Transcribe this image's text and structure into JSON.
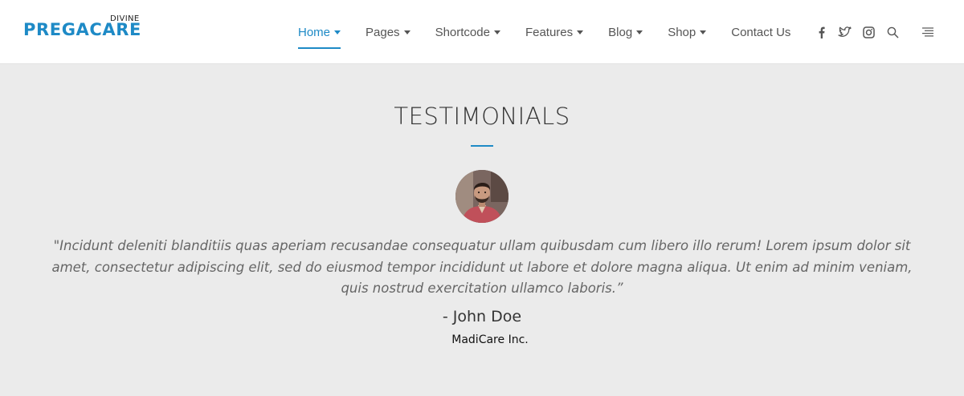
{
  "brand": {
    "logo_top": "DIVINE",
    "logo_main": "PREGACARE",
    "accent_color": "#1e8ac6"
  },
  "nav": {
    "items": [
      {
        "label": "Home",
        "has_dropdown": true,
        "active": true
      },
      {
        "label": "Pages",
        "has_dropdown": true,
        "active": false
      },
      {
        "label": "Shortcode",
        "has_dropdown": true,
        "active": false
      },
      {
        "label": "Features",
        "has_dropdown": true,
        "active": false
      },
      {
        "label": "Blog",
        "has_dropdown": true,
        "active": false
      },
      {
        "label": "Shop",
        "has_dropdown": true,
        "active": false
      },
      {
        "label": "Contact Us",
        "has_dropdown": false,
        "active": false
      }
    ]
  },
  "header_icons": [
    "facebook-icon",
    "twitter-icon",
    "instagram-icon",
    "search-icon",
    "menu-icon"
  ],
  "testimonials": {
    "title": "TESTIMONIALS",
    "quote": "\"Incidunt deleniti blanditiis quas aperiam recusandae consequatur ullam quibusdam cum libero illo rerum! Lorem ipsum dolor sit amet, consectetur adipiscing elit, sed do eiusmod tempor incididunt ut labore et dolore magna aliqua. Ut enim ad minim veniam, quis nostrud exercitation ullamco laboris.”",
    "author": "- John Doe",
    "company": "MadiCare Inc."
  }
}
